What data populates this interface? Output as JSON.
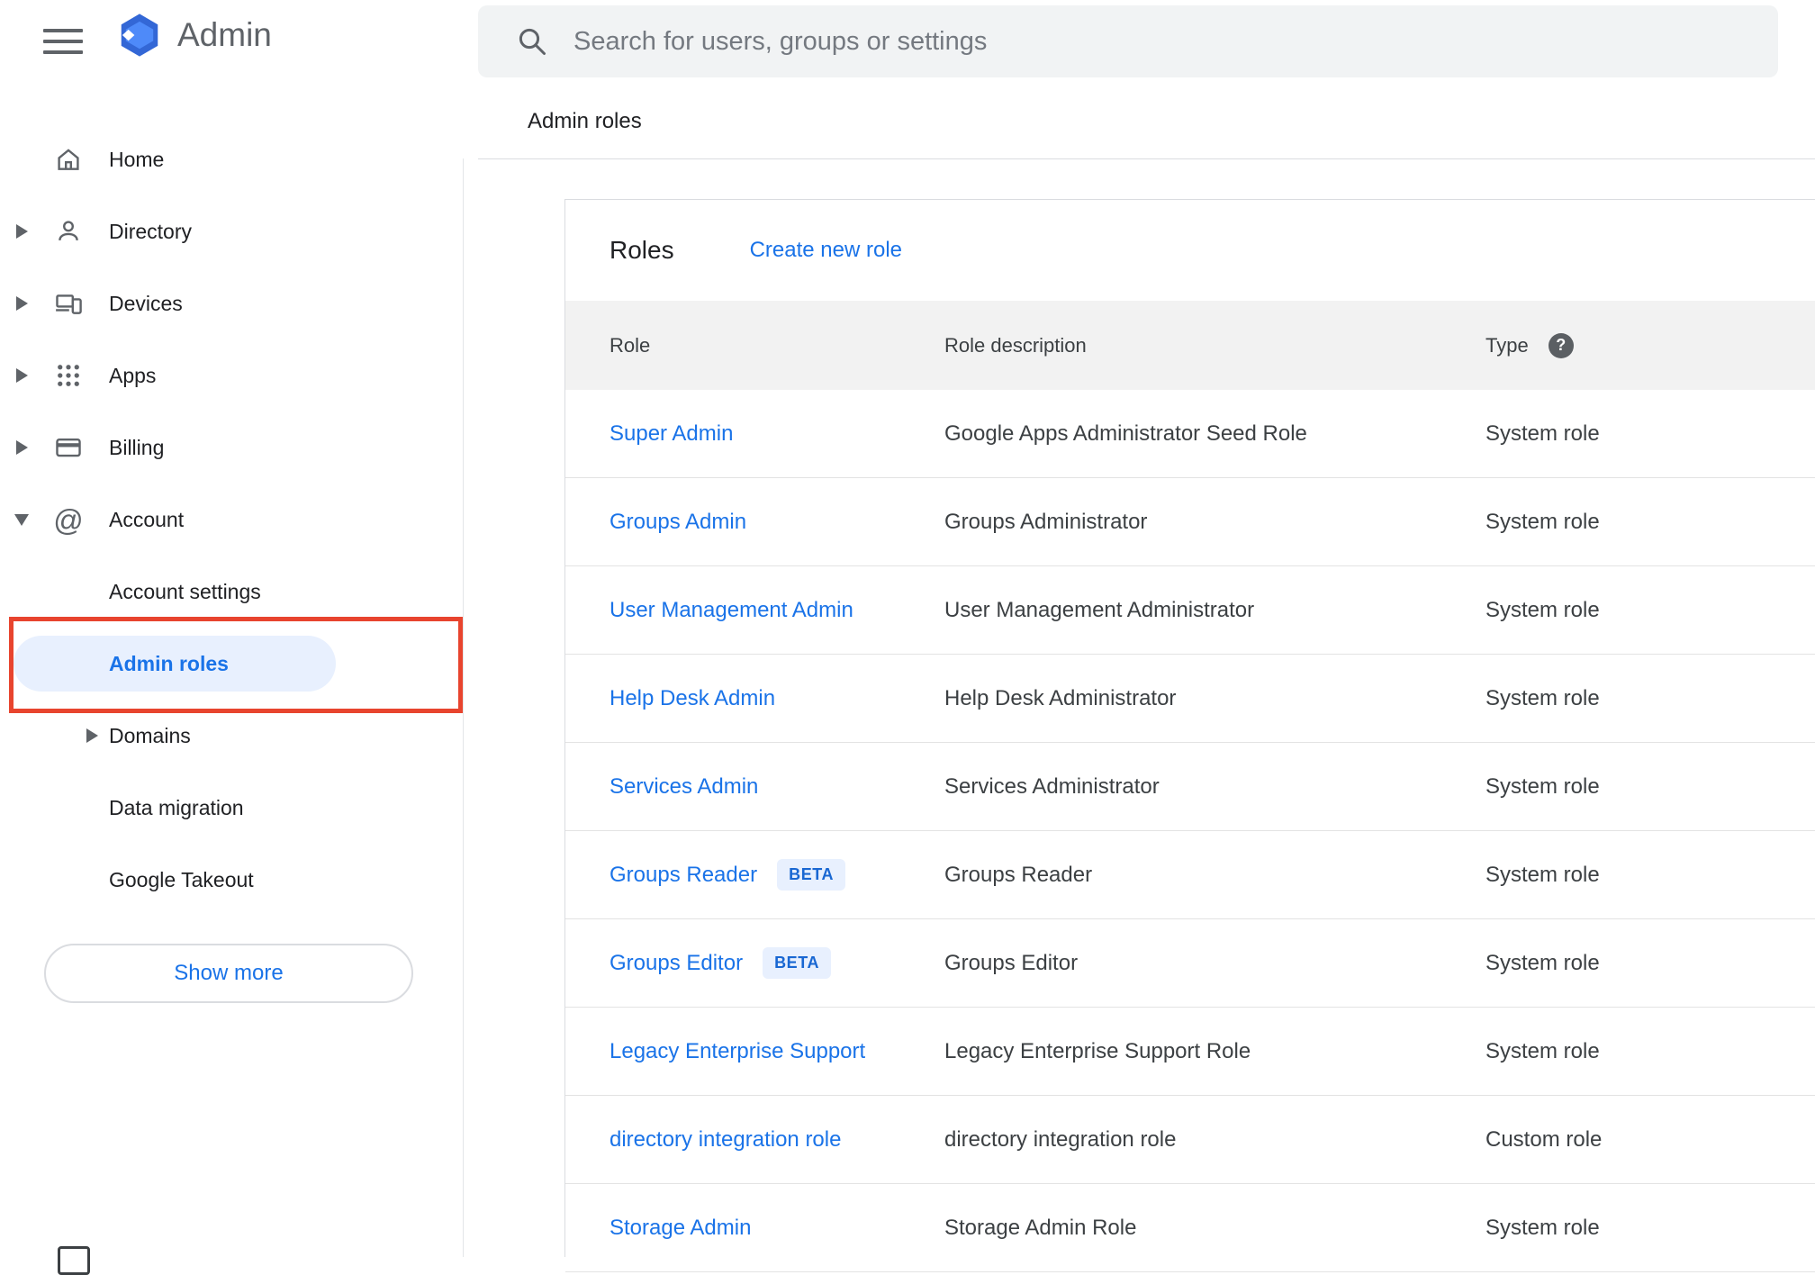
{
  "app": {
    "logo_text": "Admin"
  },
  "colors": {
    "link_blue": "#1a73e8",
    "selected_item_bg": "#e8f0fe",
    "beta_badge_bg": "#e8f0fe",
    "beta_badge_text": "#1967d2",
    "annotation_red": "#e8442e",
    "search_bar_bg": "#f1f3f4"
  },
  "search": {
    "placeholder": "Search for users, groups or settings"
  },
  "breadcrumb": "Admin roles",
  "sidebar": {
    "items": [
      {
        "label": "Home"
      },
      {
        "label": "Directory"
      },
      {
        "label": "Devices"
      },
      {
        "label": "Apps"
      },
      {
        "label": "Billing"
      },
      {
        "label": "Account"
      }
    ],
    "account_children": [
      {
        "label": "Account settings"
      },
      {
        "label": "Admin roles"
      },
      {
        "label": "Domains"
      },
      {
        "label": "Data migration"
      },
      {
        "label": "Google Takeout"
      }
    ],
    "show_more_label": "Show more"
  },
  "main": {
    "card_title": "Roles",
    "create_link_label": "Create new role",
    "table": {
      "headers": [
        "Role",
        "Role description",
        "Type"
      ],
      "beta_label": "BETA",
      "rows": [
        {
          "role": "Super Admin",
          "beta": false,
          "description": "Google Apps Administrator Seed Role",
          "type": "System role"
        },
        {
          "role": "Groups Admin",
          "beta": false,
          "description": "Groups Administrator",
          "type": "System role"
        },
        {
          "role": "User Management Admin",
          "beta": false,
          "description": "User Management Administrator",
          "type": "System role"
        },
        {
          "role": "Help Desk Admin",
          "beta": false,
          "description": "Help Desk Administrator",
          "type": "System role"
        },
        {
          "role": "Services Admin",
          "beta": false,
          "description": "Services Administrator",
          "type": "System role"
        },
        {
          "role": "Groups Reader",
          "beta": true,
          "description": "Groups Reader",
          "type": "System role"
        },
        {
          "role": "Groups Editor",
          "beta": true,
          "description": "Groups Editor",
          "type": "System role"
        },
        {
          "role": "Legacy Enterprise Support",
          "beta": false,
          "description": "Legacy Enterprise Support Role",
          "type": "System role"
        },
        {
          "role": "directory integration role",
          "beta": false,
          "description": "directory integration role",
          "type": "Custom role"
        },
        {
          "role": "Storage Admin",
          "beta": false,
          "description": "Storage Admin Role",
          "type": "System role"
        }
      ]
    }
  }
}
